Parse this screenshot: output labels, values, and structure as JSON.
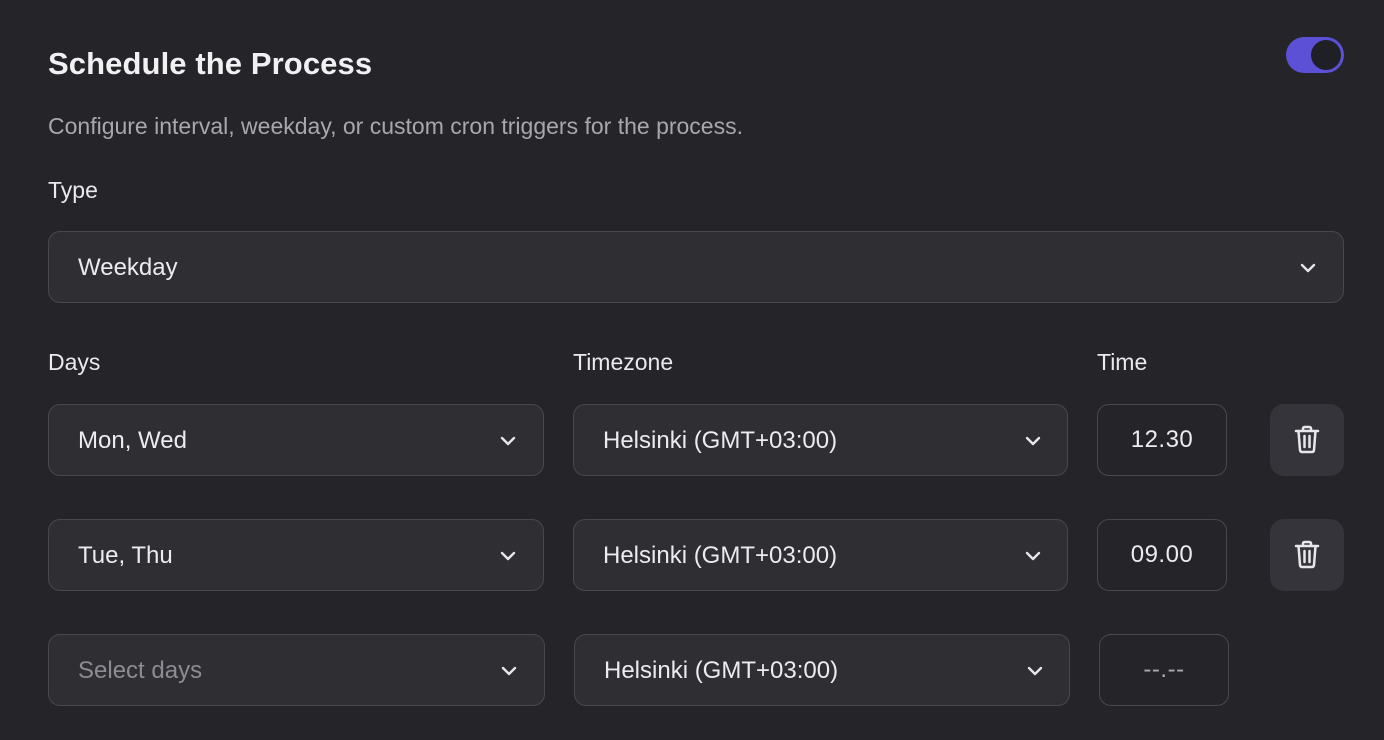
{
  "header": {
    "title": "Schedule the Process",
    "subtitle": "Configure interval, weekday, or custom cron triggers for the process.",
    "enabled": true,
    "accent_color": "#5b50d6"
  },
  "type": {
    "label": "Type",
    "value": "Weekday"
  },
  "columns": {
    "days": "Days",
    "timezone": "Timezone",
    "time": "Time"
  },
  "schedules": [
    {
      "days": "Mon, Wed",
      "timezone": "Helsinki (GMT+03:00)",
      "time": "12.30"
    },
    {
      "days": "Tue, Thu",
      "timezone": "Helsinki (GMT+03:00)",
      "time": "09.00"
    }
  ],
  "new_schedule": {
    "days_placeholder": "Select days",
    "timezone": "Helsinki (GMT+03:00)",
    "time_placeholder": "--.--"
  },
  "icons": {
    "dropdown": "chevron-down-icon",
    "delete": "trash-icon"
  }
}
